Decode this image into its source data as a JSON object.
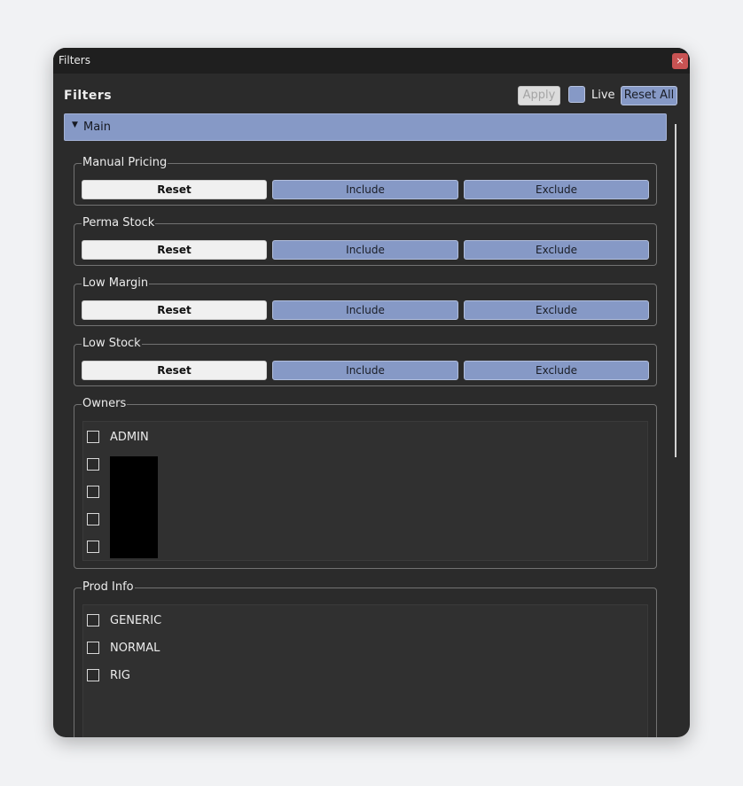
{
  "window": {
    "title": "Filters",
    "close_glyph": "×"
  },
  "header": {
    "title": "Filters",
    "apply_label": "Apply",
    "live_label": "Live",
    "live_checked": true,
    "reset_all_label": "Reset All"
  },
  "main_section": {
    "arrow": "▼",
    "label": "Main"
  },
  "filter_groups": [
    {
      "title": "Manual Pricing",
      "reset": "Reset",
      "include": "Include",
      "exclude": "Exclude"
    },
    {
      "title": "Perma Stock",
      "reset": "Reset",
      "include": "Include",
      "exclude": "Exclude"
    },
    {
      "title": "Low Margin",
      "reset": "Reset",
      "include": "Include",
      "exclude": "Exclude"
    },
    {
      "title": "Low Stock",
      "reset": "Reset",
      "include": "Include",
      "exclude": "Exclude"
    }
  ],
  "owners": {
    "title": "Owners",
    "items": [
      {
        "label": "ADMIN",
        "checked": false
      },
      {
        "label": "",
        "checked": false
      },
      {
        "label": "",
        "checked": false
      },
      {
        "label": "",
        "checked": false
      },
      {
        "label": "",
        "checked": false
      }
    ]
  },
  "prod_info": {
    "title": "Prod Info",
    "items": [
      {
        "label": "GENERIC",
        "checked": false
      },
      {
        "label": "NORMAL",
        "checked": false
      },
      {
        "label": "RIG",
        "checked": false
      }
    ]
  },
  "colors": {
    "accent": "#8699c6",
    "panel_bg": "#2b2b2b",
    "titlebar_bg": "#1f1f1f",
    "close_red": "#c85353"
  }
}
